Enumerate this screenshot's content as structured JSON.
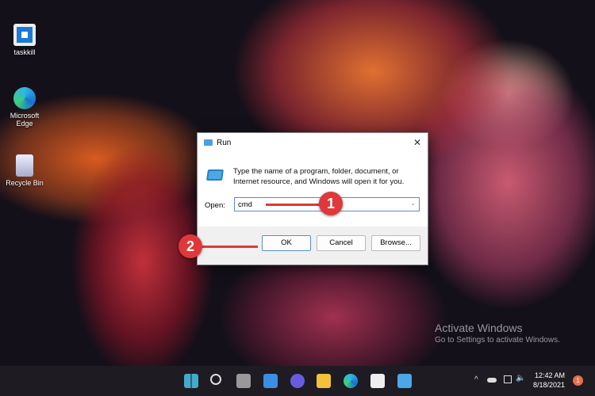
{
  "desktop": {
    "icons": [
      {
        "label": "taskkill"
      },
      {
        "label": "Microsoft Edge"
      },
      {
        "label": "Recycle Bin"
      }
    ]
  },
  "run_dialog": {
    "title": "Run",
    "description": "Type the name of a program, folder, document, or Internet resource, and Windows will open it for you.",
    "open_label": "Open:",
    "open_value": "cmd",
    "ok": "OK",
    "cancel": "Cancel",
    "browse": "Browse..."
  },
  "annotations": {
    "step1": "1",
    "step2": "2"
  },
  "watermark": {
    "title": "Activate Windows",
    "subtitle": "Go to Settings to activate Windows."
  },
  "taskbar": {
    "time": "12:42 AM",
    "date": "8/18/2021",
    "notification_count": "1"
  },
  "colors": {
    "accent": "#e0383a",
    "taskbar": "#1e1c22"
  }
}
